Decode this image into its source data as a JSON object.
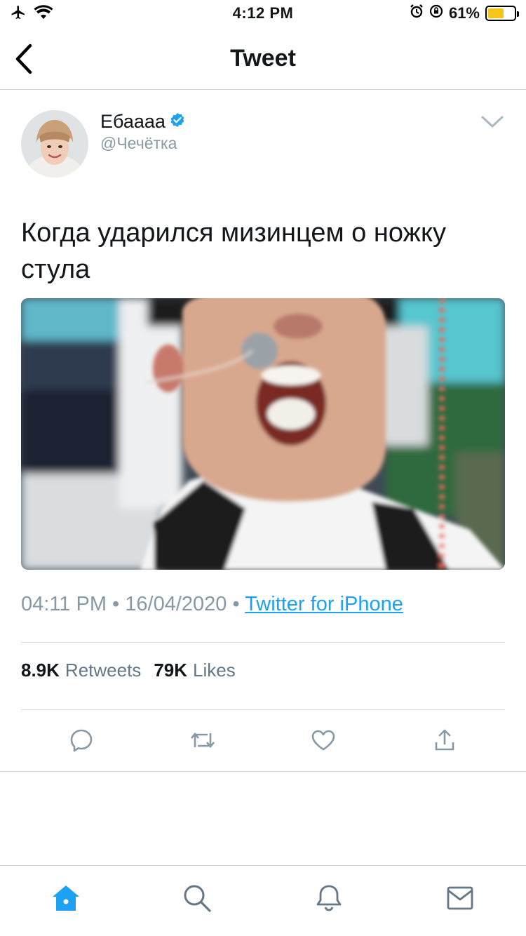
{
  "status_bar": {
    "time": "4:12 PM",
    "battery": "61%",
    "battery_level": 0.61
  },
  "nav": {
    "title": "Tweet"
  },
  "tweet": {
    "author_name": "Ебаааа",
    "author_handle": "@Чечётка",
    "text": "Когда ударился мизинцем о ножку стула",
    "time": "04:11 PM",
    "separator": "•",
    "date": "16/04/2020",
    "source": "Twitter for iPhone",
    "retweets_count": "8.9K",
    "retweets_label": "Retweets",
    "likes_count": "79K",
    "likes_label": "Likes"
  },
  "colors": {
    "accent": "#1da1f2",
    "muted": "#8899a6",
    "text": "#14171a"
  }
}
